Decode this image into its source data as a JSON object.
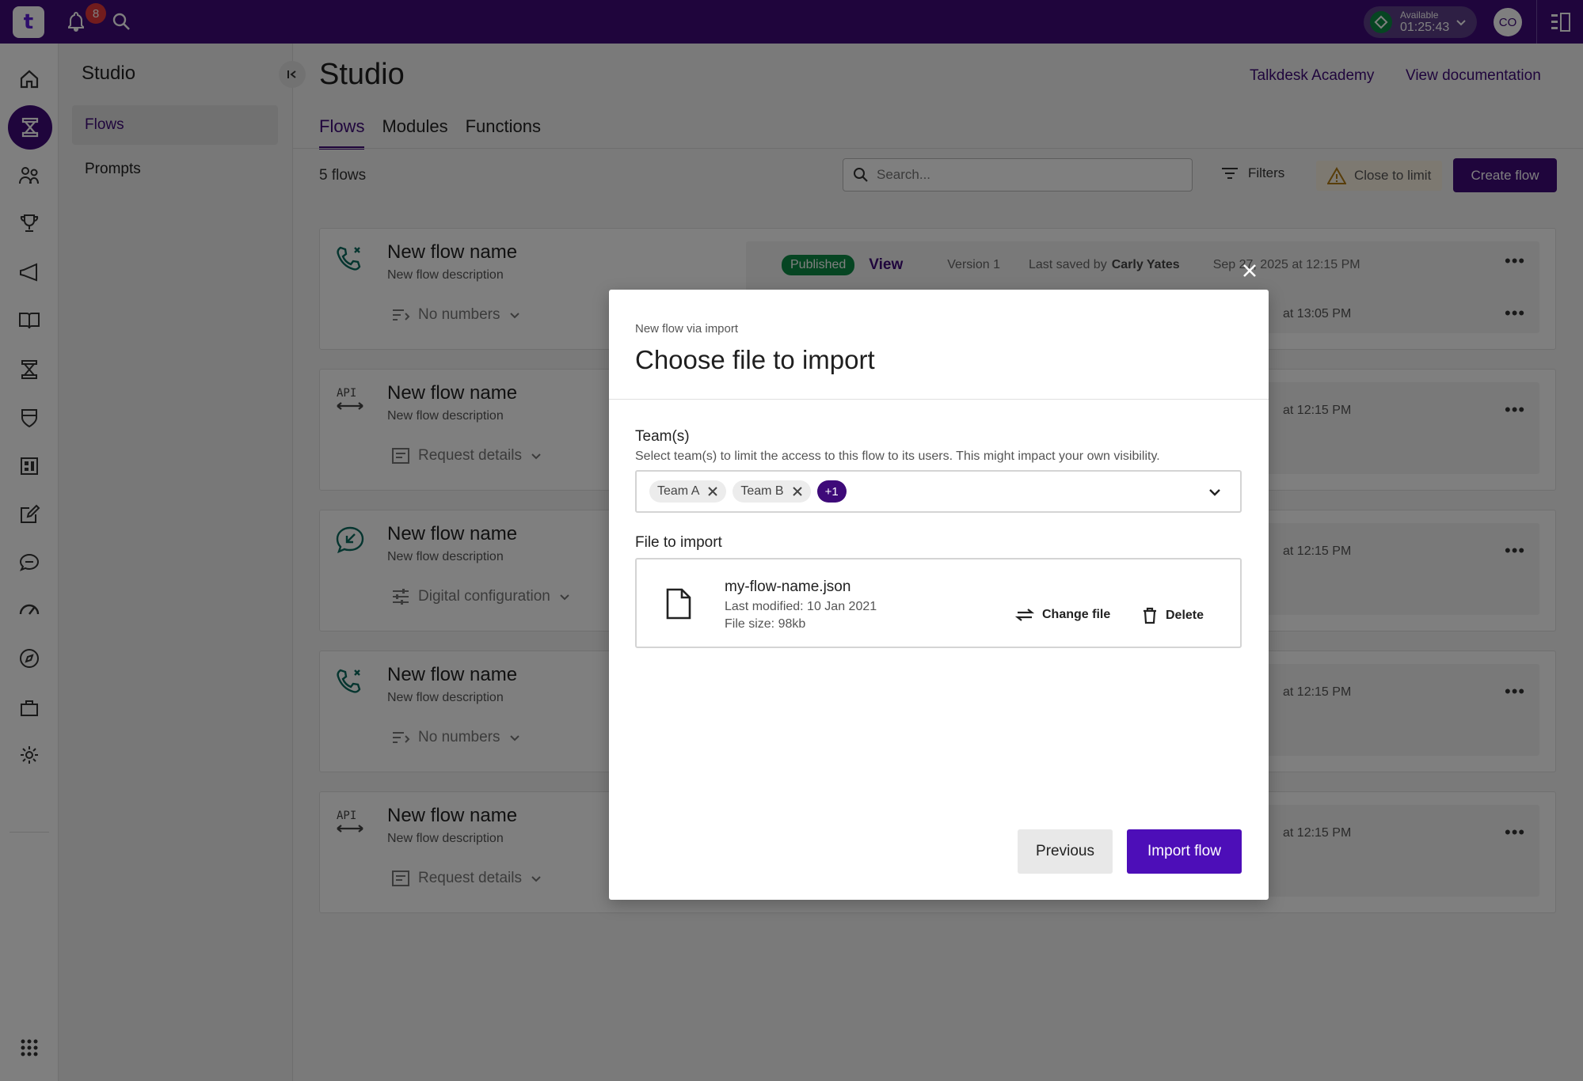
{
  "topbar": {
    "logo_text": "t",
    "notification_count": "8",
    "status_label": "Available",
    "status_time": "01:25:43",
    "avatar_initials": "CO"
  },
  "subnav": {
    "title": "Studio",
    "items": [
      {
        "label": "Flows"
      },
      {
        "label": "Prompts"
      }
    ]
  },
  "main": {
    "title": "Studio",
    "link_academy": "Talkdesk Academy",
    "link_docs": "View documentation",
    "tabs": [
      {
        "label": "Flows"
      },
      {
        "label": "Modules"
      },
      {
        "label": "Functions"
      }
    ],
    "count_label": "5 flows",
    "search_placeholder": "Search...",
    "filters_label": "Filters",
    "limit_label": "Close to limit",
    "create_label": "Create flow"
  },
  "cards": [
    {
      "name": "New flow name",
      "desc": "New flow description",
      "extra": "No numbers",
      "icon": "phone-flow-icon",
      "ts1": "Sep 27, 2025 at 12:15 PM",
      "ts2": "at 13:05 PM",
      "published": "Published",
      "view": "View",
      "version": "Version 1",
      "last_saved": "Last saved by",
      "saved_by": "Carly Yates"
    },
    {
      "name": "New flow name",
      "desc": "New flow description",
      "extra": "Request details",
      "icon": "api-icon",
      "ts1": "at 12:15 PM"
    },
    {
      "name": "New flow name",
      "desc": "New flow description",
      "extra": "Digital configuration",
      "icon": "digital-flow-icon",
      "ts1": "at 12:15 PM"
    },
    {
      "name": "New flow name",
      "desc": "New flow description",
      "extra": "No numbers",
      "icon": "phone-flow-icon",
      "ts1": "at 12:15 PM"
    },
    {
      "name": "New flow name",
      "desc": "New flow description",
      "extra": "Request details",
      "icon": "api-icon",
      "ts1": "at 12:15 PM"
    }
  ],
  "modal": {
    "eyebrow": "New flow via import",
    "title": "Choose file to import",
    "teams_label": "Team(s)",
    "teams_help": "Select team(s) to limit the access to this flow to its users. This might impact your own visibility.",
    "chips": [
      "Team A",
      "Team B"
    ],
    "more_chip": "+1",
    "file_label": "File to import",
    "file_name": "my-flow-name.json",
    "file_modified": "Last modified: 10 Jan 2021",
    "file_size": "File size: 98kb",
    "change_file": "Change file",
    "delete": "Delete",
    "previous": "Previous",
    "import": "Import flow"
  },
  "colors": {
    "brand": "#3e0a79",
    "primary_button": "#4d0eb8",
    "published": "#0c8b45",
    "badge": "#e5393b"
  }
}
